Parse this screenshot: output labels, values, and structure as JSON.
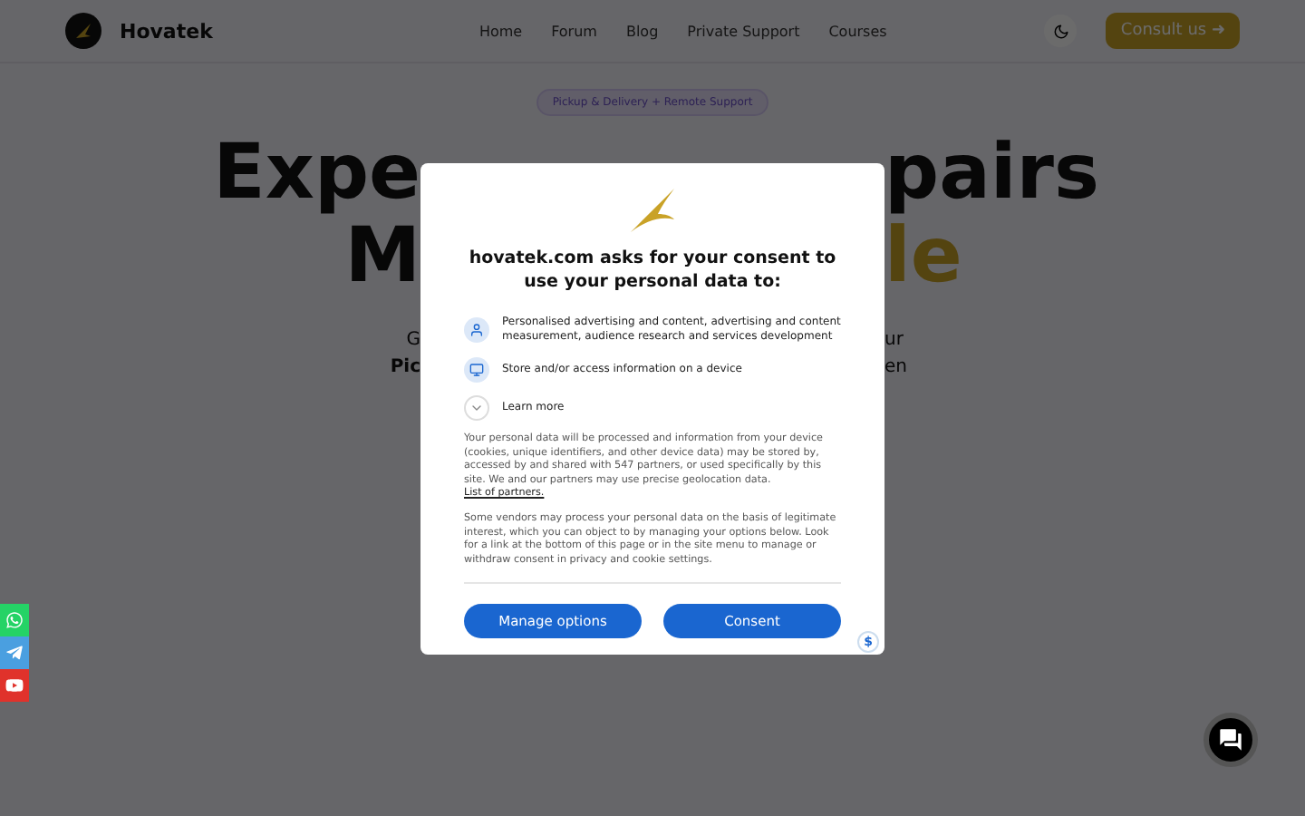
{
  "navbar": {
    "brand": "Hovatek",
    "links": [
      {
        "label": "Home"
      },
      {
        "label": "Forum"
      },
      {
        "label": "Blog"
      },
      {
        "label": "Private Support"
      },
      {
        "label": "Courses"
      }
    ],
    "cta": "Consult us ➜"
  },
  "hero": {
    "badge": "Pickup & Delivery + Remote Support",
    "lines": [
      {
        "kind": "heading",
        "left": "Expe",
        "right": "pairs",
        "right_accent": false
      },
      {
        "kind": "heading",
        "left": "M",
        "right": "le",
        "right_accent": true
      },
      {
        "kind": "text",
        "left": "G",
        "right": "ur",
        "left_bold": false
      },
      {
        "kind": "text",
        "left": "Pic",
        "right": "en",
        "left_bold": true
      }
    ]
  },
  "social": [
    {
      "kind": "whatsapp",
      "color": "#25d366"
    },
    {
      "kind": "telegram",
      "color": "#4a9fe0"
    },
    {
      "kind": "youtube",
      "color": "#e0322b"
    }
  ],
  "consent": {
    "title": "hovatek.com asks for your consent to use your personal data to:",
    "purposes": [
      {
        "kind": "person",
        "text": "Personalised advertising and content, advertising and content measurement, audience research and services development"
      },
      {
        "kind": "device",
        "text": "Store and/or access information on a device"
      }
    ],
    "learn_more": {
      "label": "Learn more",
      "expanded": false
    },
    "paragraph_1": "Your personal data will be processed and information from your device (cookies, unique identifiers, and other device data) may be stored by, accessed by and shared with 547 partners, or used specifically by this site. We and our partners may use precise geolocation data.",
    "partners_link": "List of partners.",
    "paragraph_2": "Some vendors may process your personal data on the basis of legitimate interest, which you can object to by managing your options below. Look for a link at the bottom of this page or in the site menu to manage or withdraw consent in privacy and cookie settings.",
    "buttons": [
      {
        "label": "Manage options"
      },
      {
        "label": "Consent"
      }
    ],
    "badge": "$"
  }
}
